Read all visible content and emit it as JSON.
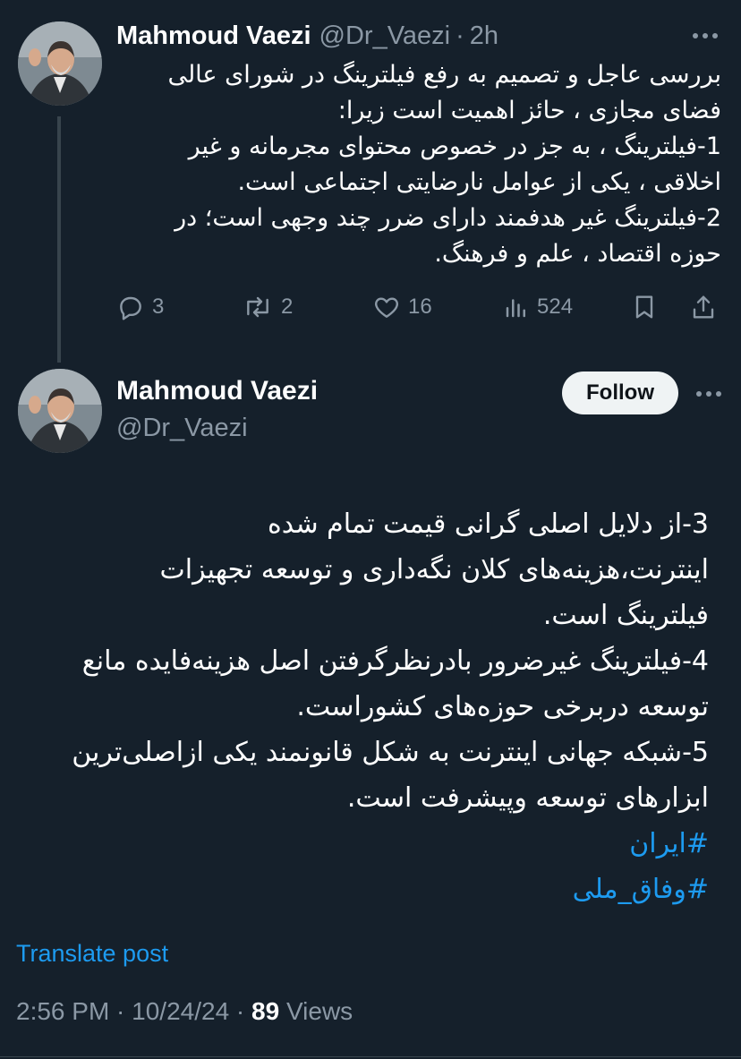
{
  "tweet1": {
    "name": "Mahmoud Vaezi",
    "handle": "@Dr_Vaezi",
    "dot": "·",
    "time": "2h",
    "lines": [
      "بررسی عاجل و تصمیم به رفع فیلترینگ در شورای عالی",
      "فضای مجازی ، حائز اهمیت است زیرا:",
      "1-فیلترینگ ، به جز در خصوص محتوای مجرمانه و غیر",
      "اخلاقی ، یکی از عوامل نارضایتی اجتماعی است.",
      "2-فیلترینگ غیر هدفمند دارای ضرر چند وجهی است؛ در",
      "حوزه اقتصاد ، علم و فرهنگ."
    ],
    "replies": "3",
    "reposts": "2",
    "likes": "16",
    "views": "524"
  },
  "tweet2": {
    "name": "Mahmoud Vaezi",
    "handle": "@Dr_Vaezi",
    "follow_label": "Follow",
    "lines": [
      "3-از دلایل اصلی گرانی قیمت تمام شده",
      "اینترنت،هزینه‌های کلان نگه‌داری و توسعه تجهیزات",
      "فیلترینگ است.",
      "4-فیلترینگ غیرضرور بادرنظرگرفتن اصل هزینه‌فایده مانع",
      "توسعه دربرخی حوزه‌های کشوراست.",
      "5-شبکه جهانی اینترنت به شکل قانونمند یکی ازاصلی‌ترین",
      "ابزارهای توسعه وپیشرفت است."
    ],
    "hashtags": [
      "#ایران",
      "#وفاق_ملی"
    ],
    "translate_label": "Translate post",
    "timestamp": "2:56 PM · 10/24/24 · ",
    "view_count": "89",
    "views_label": " Views"
  },
  "colors": {
    "background": "#15202b",
    "accent": "#1d9bf0",
    "muted": "#8b98a5"
  },
  "icons": [
    "more-icon",
    "reply-icon",
    "repost-icon",
    "like-icon",
    "views-icon",
    "bookmark-icon",
    "share-icon"
  ]
}
